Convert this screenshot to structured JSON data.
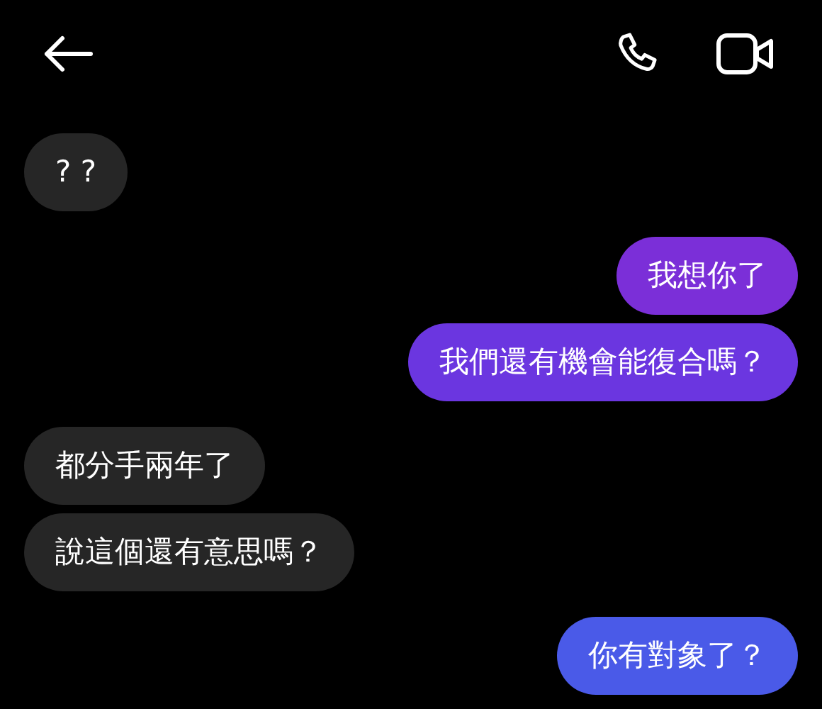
{
  "messages": [
    {
      "kind": "received",
      "text": "? ?",
      "color": "#262626"
    },
    {
      "kind": "sent",
      "text": "我想你了",
      "color": "#7b2fd8"
    },
    {
      "kind": "sent",
      "text": "我們還有機會能復合嗎？",
      "color": "#6b36e0"
    },
    {
      "kind": "received",
      "text": "都分手兩年了",
      "color": "#262626"
    },
    {
      "kind": "received",
      "text": "說這個還有意思嗎？",
      "color": "#262626"
    },
    {
      "kind": "sent",
      "text": "你有對象了？",
      "color": "#4a5ae8"
    }
  ]
}
